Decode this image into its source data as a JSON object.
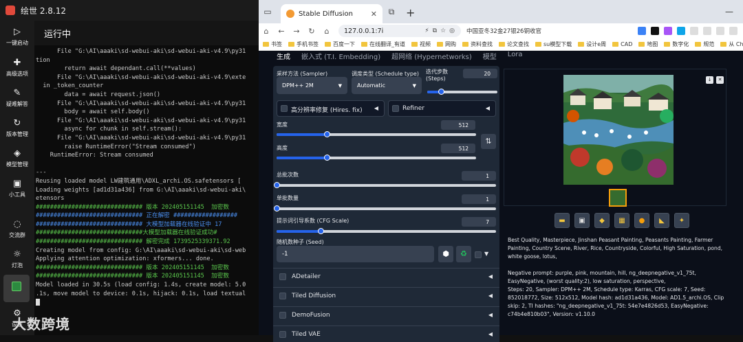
{
  "launcher": {
    "title": "绘世 2.8.12",
    "sidebar": [
      {
        "label": "一键启动",
        "icon": "play-icon"
      },
      {
        "label": "高级选项",
        "icon": "puzzle-icon"
      },
      {
        "label": "疑难解答",
        "icon": "wrench-icon"
      },
      {
        "label": "版本管理",
        "icon": "history-icon"
      },
      {
        "label": "模型管理",
        "icon": "cube-icon"
      },
      {
        "label": "小工具",
        "icon": "toolbox-icon"
      },
      {
        "label": "交流群",
        "icon": "chat-icon"
      },
      {
        "label": "灯泡",
        "icon": "bulb-icon"
      },
      {
        "label": "",
        "icon": "console-icon"
      },
      {
        "label": "设置",
        "icon": "gear-icon"
      }
    ],
    "console_header": "运行中",
    "console_lines": [
      {
        "t": "      File \"G:\\AI\\aaaki\\sd-webui-aki\\sd-webui-aki-v4.9\\py31",
        "c": ""
      },
      {
        "t": "tion",
        "c": ""
      },
      {
        "t": "        return await dependant.call(**values)",
        "c": ""
      },
      {
        "t": "      File \"G:\\AI\\aaaki\\sd-webui-aki\\sd-webui-aki-v4.9\\exte",
        "c": ""
      },
      {
        "t": "  in _token_counter",
        "c": ""
      },
      {
        "t": "        data = await request.json()",
        "c": ""
      },
      {
        "t": "      File \"G:\\AI\\aaaki\\sd-webui-aki\\sd-webui-aki-v4.9\\py31",
        "c": ""
      },
      {
        "t": "        body = await self.body()",
        "c": ""
      },
      {
        "t": "      File \"G:\\AI\\aaaki\\sd-webui-aki\\sd-webui-aki-v4.9\\py31",
        "c": ""
      },
      {
        "t": "        async for chunk in self.stream():",
        "c": ""
      },
      {
        "t": "      File \"G:\\AI\\aaaki\\sd-webui-aki\\sd-webui-aki-v4.9\\py31",
        "c": ""
      },
      {
        "t": "        raise RuntimeError(\"Stream consumed\")",
        "c": ""
      },
      {
        "t": "    RuntimeError: Stream consumed",
        "c": ""
      },
      {
        "t": "",
        "c": ""
      },
      {
        "t": "---",
        "c": ""
      },
      {
        "t": "Reusing loaded model LW建筑通用\\ADXL_archi.OS.safetensors [",
        "c": ""
      },
      {
        "t": "Loading weights [ad1d31a436] from G:\\AI\\aaaki\\sd-webui-aki\\",
        "c": ""
      },
      {
        "t": "etensors",
        "c": ""
      },
      {
        "t": "############################## 版本 202405151145  加密数",
        "c": "g"
      },
      {
        "t": "############################## 正在解密 ##################",
        "c": "b"
      },
      {
        "t": "############################## 大模型加载器在线验证中 17",
        "c": "b"
      },
      {
        "t": "##############################大模型加载器在线验证成功#",
        "c": "g"
      },
      {
        "t": "############################## 解密完成 1739525339371.92",
        "c": "g"
      },
      {
        "t": "Creating model from config: G:\\AI\\aaaki\\sd-webui-aki\\sd-web",
        "c": ""
      },
      {
        "t": "Applying attention optimization: xformers... done.",
        "c": ""
      },
      {
        "t": "############################## 版本 202405151145  加密数",
        "c": "g"
      },
      {
        "t": "############################## 版本 202405151145  加密数",
        "c": "g"
      },
      {
        "t": "Model loaded in 30.5s (load config: 1.4s, create model: 5.0",
        "c": ""
      },
      {
        "t": ".1s, move model to device: 0.1s, hijack: 0.1s, load textual",
        "c": ""
      }
    ],
    "watermark": "大数跨境"
  },
  "browser": {
    "tab_title": "Stable Diffusion",
    "url": "127.0.0.1:7i",
    "news": "中国亚冬32金27银26铜收官",
    "bookmarks": [
      "书签",
      "手机书签",
      "百度一下",
      "在线翻译_有道",
      "视频",
      "网购",
      "资料查找",
      "论文查找",
      "su模型下载",
      "设计e周",
      "CAD",
      "地图",
      "数字化",
      "规范",
      "从 Chrom"
    ]
  },
  "sd": {
    "tabs": [
      "生成",
      "嵌入式 (T.I. Embedding)",
      "超网络 (Hypernetworks)",
      "模型",
      "Lora"
    ],
    "sampler_label": "采样方法 (Sampler)",
    "sampler_value": "DPM++ 2M",
    "schedule_label": "调度类型 (Schedule type)",
    "schedule_value": "Automatic",
    "steps_label": "迭代步数 (Steps)",
    "steps_value": "20",
    "hires_label": "高分辨率修复 (Hires. fix)",
    "refiner_label": "Refiner",
    "width_label": "宽度",
    "width_value": "512",
    "height_label": "高度",
    "height_value": "512",
    "batch_count_label": "总批次数",
    "batch_count_value": "1",
    "batch_size_label": "单批数量",
    "batch_size_value": "1",
    "cfg_label": "提示词引导系数 (CFG Scale)",
    "cfg_value": "7",
    "seed_label": "随机数种子 (Seed)",
    "seed_value": "-1",
    "accordions": [
      "ADetailer",
      "Tiled Diffusion",
      "DemoFusion",
      "Tiled VAE"
    ],
    "info_prompt": "Best Quality, Masterpiece, Jinshan Peasant Painting, Peasants Painting, Farmer Painting, Country Scene, River, Rice, Countryside, Colorful, High Saturation, pond, white goose, lotus,",
    "info_params": "Negative prompt: purple, pink, mountain, hill, ng_deepnegative_v1_75t, EasyNegative, (worst quality:2), low saturation, perspective,\nSteps: 20, Sampler: DPM++ 2M, Schedule type: Karras, CFG scale: 7, Seed: 852018772, Size: 512x512, Model hash: ad1d31a436, Model: AD1.5_archi.OS, Clip skip: 2, TI hashes: \"ng_deepnegative_v1_75t: 54e7e4826d53, EasyNegative: c74b4e810b03\", Version: v1.10.0"
  },
  "slider_levels": {
    "steps": 0.2,
    "width": 0.25,
    "height": 0.25,
    "batch_count": 0.0,
    "batch_size": 0.0,
    "cfg": 0.2
  }
}
